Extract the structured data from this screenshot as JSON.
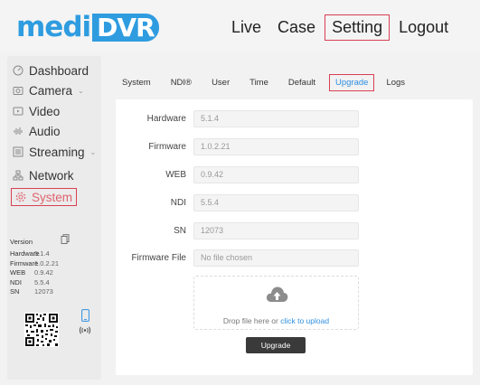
{
  "brand": {
    "medi": "medi",
    "dvr": "DVR",
    "accent": "#2f9ce0"
  },
  "topnav": [
    {
      "id": "live",
      "label": "Live"
    },
    {
      "id": "case",
      "label": "Case"
    },
    {
      "id": "setting",
      "label": "Setting",
      "active": true
    },
    {
      "id": "logout",
      "label": "Logout"
    }
  ],
  "sidebar": {
    "items": [
      {
        "id": "dashboard",
        "label": "Dashboard",
        "icon": "dashboard-icon"
      },
      {
        "id": "camera",
        "label": "Camera",
        "icon": "camera-icon",
        "expandable": true
      },
      {
        "id": "video",
        "label": "Video",
        "icon": "video-icon"
      },
      {
        "id": "audio",
        "label": "Audio",
        "icon": "audio-icon"
      },
      {
        "id": "streaming",
        "label": "Streaming",
        "icon": "streaming-icon",
        "expandable": true
      },
      {
        "id": "network",
        "label": "Network",
        "icon": "network-icon"
      },
      {
        "id": "system",
        "label": "System",
        "icon": "gear-icon",
        "active": true
      }
    ]
  },
  "version_info": {
    "title": "Version",
    "rows": [
      {
        "key": "Hardware",
        "value": "5.1.4"
      },
      {
        "key": "Firmware",
        "value": "1.0.2.21"
      },
      {
        "key": "WEB",
        "value": "0.9.42"
      },
      {
        "key": "NDI",
        "value": "5.5.4"
      },
      {
        "key": "SN",
        "value": "12073"
      }
    ]
  },
  "tabs": [
    {
      "id": "system",
      "label": "System"
    },
    {
      "id": "ndi",
      "label": "NDI®"
    },
    {
      "id": "user",
      "label": "User"
    },
    {
      "id": "time",
      "label": "Time"
    },
    {
      "id": "default",
      "label": "Default"
    },
    {
      "id": "upgrade",
      "label": "Upgrade",
      "active": true
    },
    {
      "id": "logs",
      "label": "Logs"
    }
  ],
  "form": {
    "hardware": {
      "label": "Hardware",
      "value": "5.1.4"
    },
    "firmware": {
      "label": "Firmware",
      "value": "1.0.2.21"
    },
    "web": {
      "label": "WEB",
      "value": "0.9.42"
    },
    "ndi": {
      "label": "NDI",
      "value": "5.5.4"
    },
    "sn": {
      "label": "SN",
      "value": "12073"
    },
    "firmware_file": {
      "label": "Firmware File",
      "placeholder": "No file chosen"
    }
  },
  "upload": {
    "prefix": "Drop file here or ",
    "link": "click to upload",
    "button": "Upgrade"
  }
}
